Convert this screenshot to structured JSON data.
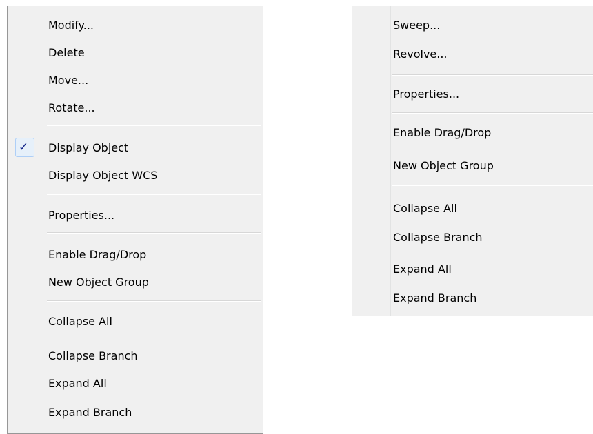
{
  "left_menu": {
    "items": [
      {
        "label": "Modify..."
      },
      {
        "label": "Delete"
      },
      {
        "label": "Move..."
      },
      {
        "label": "Rotate..."
      },
      {
        "label": "Display Object",
        "checked": true,
        "check_glyph": "✓"
      },
      {
        "label": "Display Object WCS"
      },
      {
        "label": "Properties..."
      },
      {
        "label": "Enable Drag/Drop"
      },
      {
        "label": "New Object Group"
      },
      {
        "label": "Collapse All"
      },
      {
        "label": "Collapse Branch"
      },
      {
        "label": "Expand All"
      },
      {
        "label": "Expand Branch"
      }
    ]
  },
  "right_menu": {
    "items": [
      {
        "label": "Sweep..."
      },
      {
        "label": "Revolve..."
      },
      {
        "label": "Properties..."
      },
      {
        "label": "Enable Drag/Drop"
      },
      {
        "label": "New Object Group"
      },
      {
        "label": "Collapse All"
      },
      {
        "label": "Collapse Branch"
      },
      {
        "label": "Expand All"
      },
      {
        "label": "Expand Branch"
      }
    ]
  },
  "colors": {
    "menu_background": "#f0f0f0",
    "menu_border": "#979797",
    "check_highlight": "#e6f0fa",
    "check_border": "#aecff7",
    "check_mark": "#13258a"
  },
  "icons": {
    "check": "checkmark-icon"
  }
}
